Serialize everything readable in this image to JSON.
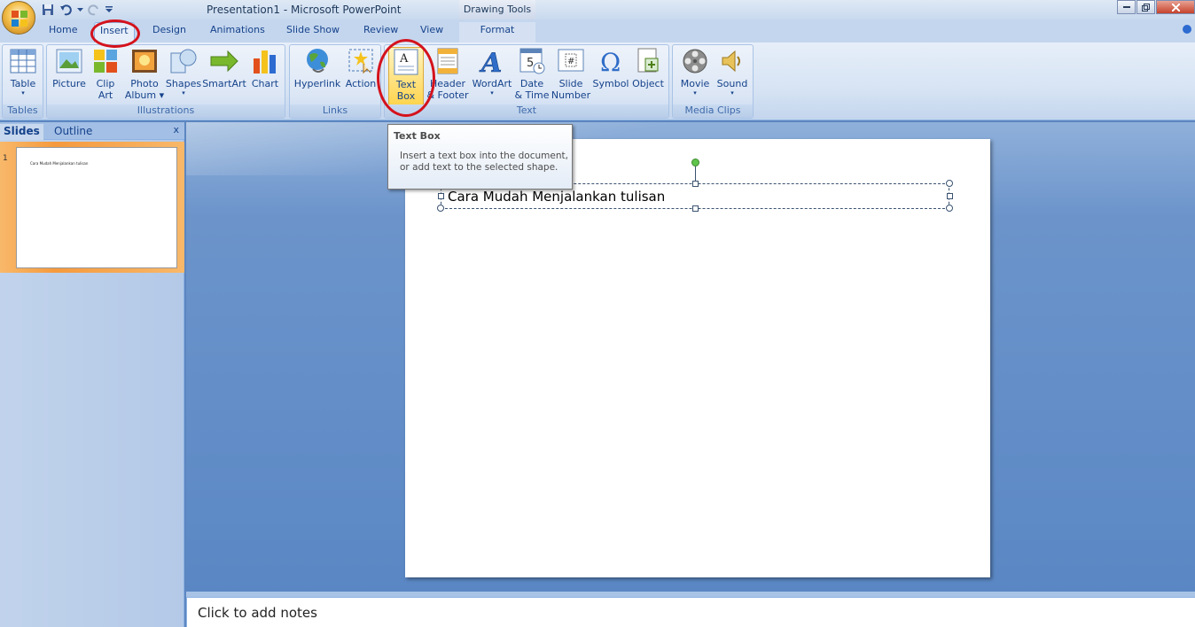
{
  "titlebar": {
    "title": "Presentation1 - Microsoft PowerPoint",
    "context_tab_group": "Drawing Tools"
  },
  "tabs": [
    {
      "label": "Home"
    },
    {
      "label": "Insert",
      "active": true
    },
    {
      "label": "Design"
    },
    {
      "label": "Animations"
    },
    {
      "label": "Slide Show"
    },
    {
      "label": "Review"
    },
    {
      "label": "View"
    },
    {
      "label": "Format"
    }
  ],
  "ribbon": {
    "groups": {
      "tables": "Tables",
      "illustrations": "Illustrations",
      "links": "Links",
      "text": "Text",
      "media": "Media Clips"
    },
    "buttons": {
      "table": [
        "Table",
        "▾"
      ],
      "picture": [
        "Picture",
        ""
      ],
      "clipart": [
        "Clip",
        "Art"
      ],
      "photoalbum": [
        "Photo",
        "Album ▾"
      ],
      "shapes": [
        "Shapes",
        "▾"
      ],
      "smartart": [
        "SmartArt",
        ""
      ],
      "chart": [
        "Chart",
        ""
      ],
      "hyperlink": [
        "Hyperlink",
        ""
      ],
      "action": [
        "Action",
        ""
      ],
      "textbox": [
        "Text",
        "Box"
      ],
      "headerfooter": [
        "Header",
        "& Footer"
      ],
      "wordart": [
        "WordArt",
        "▾"
      ],
      "datetime": [
        "Date",
        "& Time"
      ],
      "slidenumber": [
        "Slide",
        "Number"
      ],
      "symbol": [
        "Symbol",
        ""
      ],
      "object": [
        "Object",
        ""
      ],
      "movie": [
        "Movie",
        "▾"
      ],
      "sound": [
        "Sound",
        "▾"
      ]
    }
  },
  "tooltip": {
    "title": "Text Box",
    "body": "Insert a text box into the document, or add text to the selected shape."
  },
  "slide_pane": {
    "tab_slides": "Slides",
    "tab_outline": "Outline",
    "close": "x",
    "thumb_number": "1",
    "thumb_text": "Cara Mudah Menjalankan tulisan"
  },
  "slide": {
    "textbox_text": "Cara Mudah Menjalankan tulisan"
  },
  "notes": {
    "placeholder": "Click to add notes"
  },
  "colors": {
    "accent_ring": "#d4121c",
    "ribbon_bg": "#dbe6f5",
    "workspace_bg": "#5a87c4"
  }
}
